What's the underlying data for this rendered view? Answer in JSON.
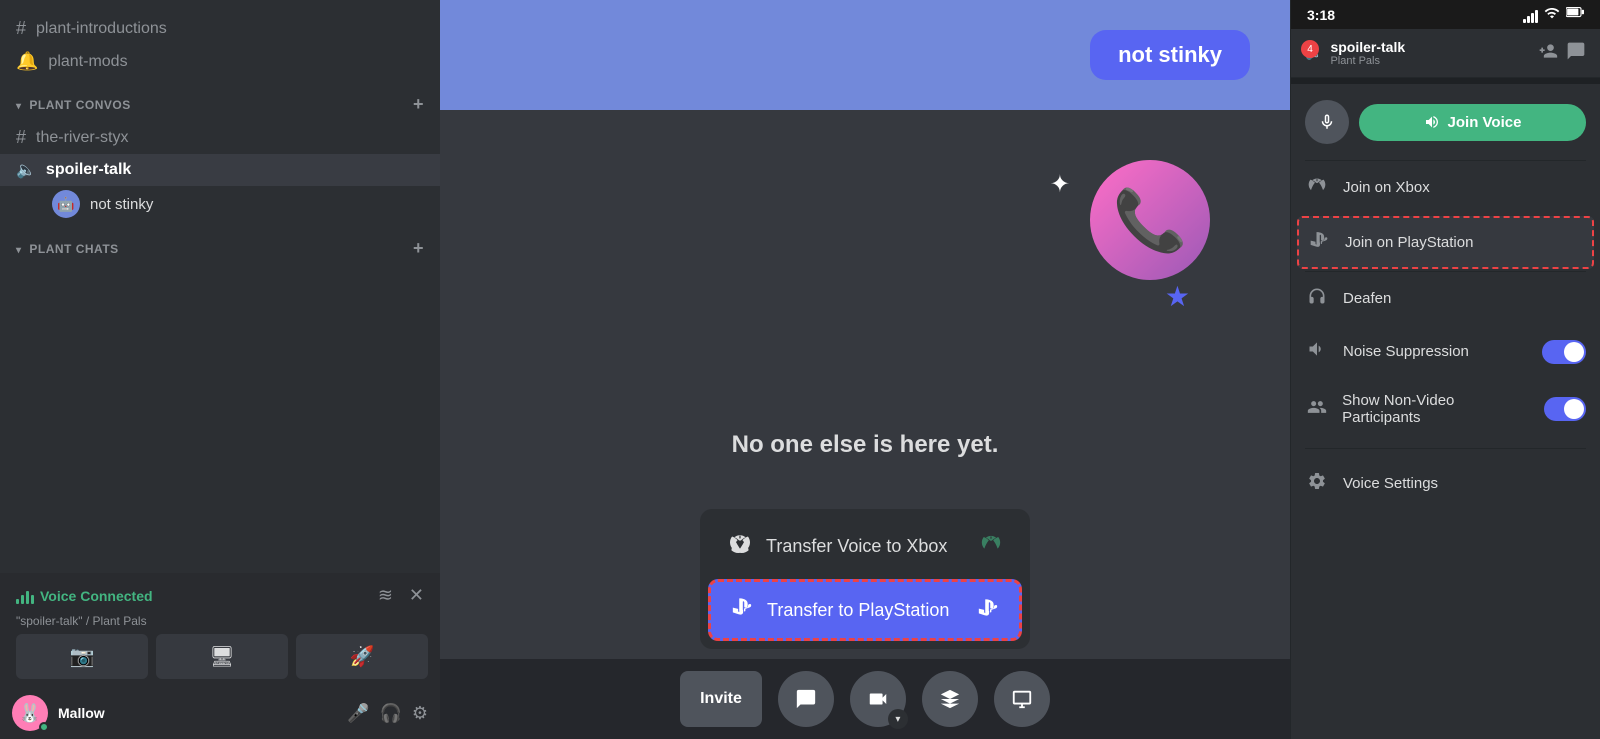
{
  "sidebar": {
    "channels_no_category": [
      {
        "icon": "#",
        "name": "plant-introductions"
      },
      {
        "icon": "🔔",
        "name": "plant-mods"
      }
    ],
    "sections": [
      {
        "label": "PLANT CONVOS",
        "channels": [
          {
            "icon": "#",
            "name": "the-river-styx",
            "active": false
          },
          {
            "icon": "🔈",
            "name": "spoiler-talk",
            "active": true,
            "voice": true
          }
        ],
        "users_in_voice": [
          {
            "name": "not stinky",
            "emoji": "🤖"
          }
        ]
      },
      {
        "label": "PLANT CHATS",
        "channels": []
      }
    ],
    "voice_connected": {
      "label": "Voice Connected",
      "channel": "\"spoiler-talk\" / Plant Pals"
    },
    "voice_buttons": [
      {
        "icon": "📷",
        "label": "camera"
      },
      {
        "icon": "🖥",
        "label": "screen-share"
      },
      {
        "icon": "🚀",
        "label": "activity"
      }
    ],
    "user": {
      "name": "Mallow",
      "emoji": "🐰"
    }
  },
  "main": {
    "not_stinky_bubble": "not stinky",
    "no_one_text": "No one else is here yet.",
    "transfer_popup": {
      "xbox": {
        "label": "Transfer Voice to Xbox",
        "icon": "xbox"
      },
      "playstation": {
        "label": "Transfer to PlayStation",
        "icon": "playstation",
        "active": true
      }
    },
    "toolbar": {
      "invite_label": "Invite",
      "buttons": [
        "chat",
        "camera",
        "activity",
        "screenshare"
      ]
    }
  },
  "right_panel": {
    "status_bar": {
      "time": "3:18",
      "battery": "🔋",
      "wifi": "wifi"
    },
    "channel": {
      "name": "spoiler-talk",
      "server": "Plant Pals",
      "badge": "4"
    },
    "join_voice_label": "Join Voice",
    "menu_items": [
      {
        "icon": "xbox",
        "label": "Join on Xbox",
        "highlighted": false
      },
      {
        "icon": "playstation",
        "label": "Join on PlayStation",
        "highlighted": true
      },
      {
        "icon": "headphones",
        "label": "Deafen",
        "highlighted": false
      },
      {
        "icon": "bars",
        "label": "Noise Suppression",
        "toggle": true,
        "highlighted": false
      },
      {
        "icon": "person",
        "label": "Show Non-Video Participants",
        "toggle": true,
        "highlighted": false
      },
      {
        "icon": "gear",
        "label": "Voice Settings",
        "highlighted": false
      }
    ]
  }
}
